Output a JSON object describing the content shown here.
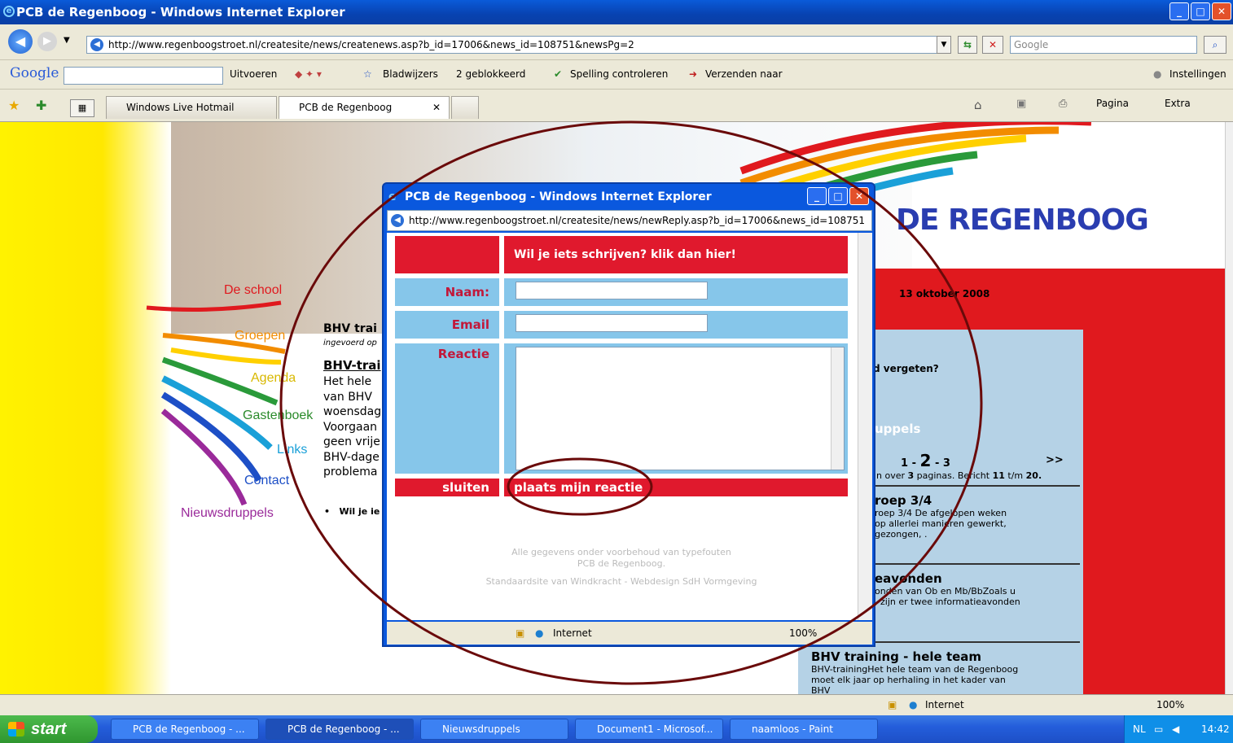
{
  "window": {
    "title": "PCB de Regenboog - Windows Internet Explorer"
  },
  "address": {
    "url": "http://www.regenboogstroet.nl/createsite/news/createnews.asp?b_id=17006&news_id=108751&newsPg=2",
    "search_placeholder": "Google"
  },
  "google_bar": {
    "logo": "Google",
    "run": "Uitvoeren",
    "bookmarks": "Bladwijzers",
    "blocked": "2 geblokkeerd",
    "spelling": "Spelling controleren",
    "send": "Verzenden naar",
    "settings": "Instellingen"
  },
  "tabs": [
    {
      "label": "Windows Live Hotmail"
    },
    {
      "label": "PCB de Regenboog"
    }
  ],
  "cmd": {
    "page": "Pagina",
    "extra": "Extra"
  },
  "site": {
    "logo": "DE REGENBOOG",
    "nav": [
      "De school",
      "Groepen",
      "Agenda",
      "Gastenboek",
      "Links",
      "Contact",
      "Nieuwsdruppels"
    ],
    "article": {
      "title": "BHV trai",
      "meta": "ingevoerd op",
      "subtitle": "BHV-trai",
      "lines": [
        "Het hele",
        "van BHV",
        "woensdag",
        "Voorgaan",
        "geen vrije",
        "BHV-dage",
        "problema"
      ],
      "bullet": "Wil je ie"
    },
    "date": "13 oktober 2008",
    "forgot": "d vergeten?",
    "news_header": "uppels",
    "pager": {
      "prev": "1",
      "current": "2",
      "next": "3",
      "more": ">>",
      "info_pre": "n over",
      "pages": "3",
      "info_mid": "paginas. Bericht",
      "from": "11",
      "to_word": "t/m",
      "to": "20."
    },
    "items": [
      {
        "title": "roep 3/4",
        "text": [
          "roep 3/4 De afgelopen weken",
          "op allerlei manieren gewerkt,",
          "gezongen, ."
        ]
      },
      {
        "title": "eavonden",
        "text": [
          "onden van Ob en Mb/BbZoals u",
          ", zijn er twee informatieavonden"
        ]
      },
      {
        "title": "BHV training - hele team",
        "text": [
          "BHV-trainingHet hele team van de Regenboog",
          "moet elk jaar op herhaling in het kader van",
          "BHV"
        ]
      }
    ]
  },
  "popup": {
    "title": "PCB de Regenboog - Windows Internet Explorer",
    "url": "http://www.regenboogstroet.nl/createsite/news/newReply.asp?b_id=17006&news_id=108751",
    "header": "Wil je iets schrijven? klik dan hier!",
    "name_label": "Naam:",
    "email_label": "Email",
    "reply_label": "Reactie",
    "close_label": "sluiten",
    "submit_label": "plaats mijn reactie",
    "footer1": "Alle gegevens onder voorbehoud van typefouten",
    "footer2": "PCB de Regenboog.",
    "footer3": "Standaardsite van Windkracht - Webdesign SdH Vormgeving",
    "zone": "Internet",
    "zoom": "100%"
  },
  "status": {
    "zone": "Internet",
    "zoom": "100%"
  },
  "taskbar": {
    "start": "start",
    "items": [
      "PCB de Regenboog - ...",
      "PCB de Regenboog - ...",
      "Nieuwsdruppels",
      "Document1 - Microsof...",
      "naamloos - Paint"
    ],
    "lang": "NL",
    "time": "14:42"
  }
}
